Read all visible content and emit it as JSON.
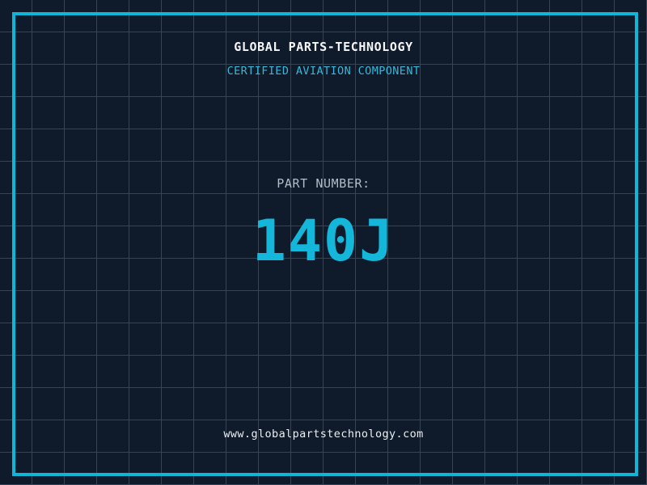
{
  "page": {
    "background_color": "#0f1a2a",
    "grid_color": "#1d4f63",
    "grid_size_px": 40,
    "frame_color": "#10b6d8"
  },
  "header": {
    "title": "GLOBAL PARTS-TECHNOLOGY",
    "title_color": "#f4f6f8",
    "subtitle": "CERTIFIED AVIATION COMPONENT",
    "subtitle_color": "#38b7d8"
  },
  "part": {
    "label": "PART NUMBER:",
    "label_color": "#b3bdc7",
    "number": "140J",
    "number_color": "#14b6d9"
  },
  "footer": {
    "url": "www.globalpartstechnology.com",
    "url_color": "#e9eef2"
  }
}
